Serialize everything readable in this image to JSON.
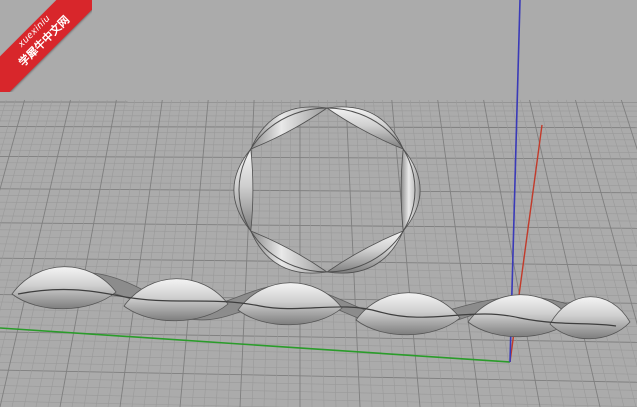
{
  "viewport": {
    "background": "#ababab",
    "grid_color": "#9a9a9a",
    "grid_major_color": "#7f7f7f",
    "axis_x_color": "#2a9c2a",
    "axis_y_color": "#c23a2a",
    "axis_z_color": "#3a3ab8"
  },
  "watermark": {
    "line1": "xuexiniu",
    "line2": "学犀牛中文网",
    "color": "#d8262b"
  },
  "objects": [
    {
      "name": "mobius-twisted-ring",
      "kind": "surface"
    },
    {
      "name": "twisted-strip",
      "kind": "surface"
    }
  ]
}
